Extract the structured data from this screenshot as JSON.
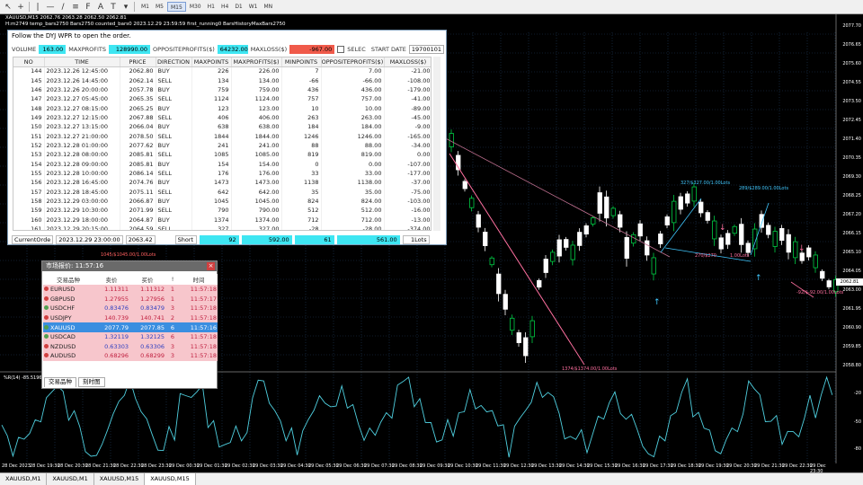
{
  "chart": {
    "symbol_line": "XAUUSD,M15  2062.76 2063.28 2062.50 2062.81",
    "info_line": "H:m2749 temp_bars2750 Bars2750 counted_bars0 2023.12.29 23:59:59 first_running0 BarsHistoryMaxBars2750",
    "prices": [
      "2077.70",
      "2076.65",
      "2075.60",
      "2074.55",
      "2073.50",
      "2072.45",
      "2071.40",
      "2070.35",
      "2069.30",
      "2068.25",
      "2067.20",
      "2066.15",
      "2065.10",
      "2064.05",
      "2063.00",
      "2061.95",
      "2060.90",
      "2059.85",
      "2058.80"
    ],
    "current_price": "2062.81",
    "indicator_label": "%R(14) -85.5196",
    "indicator_levels": [
      "-20",
      "-50",
      "-80"
    ],
    "times": [
      "28 Dec 2023",
      "28 Dec 19:30",
      "28 Dec 20:30",
      "28 Dec 21:30",
      "28 Dec 22:30",
      "28 Dec 23:30",
      "29 Dec 00:30",
      "29 Dec 01:30",
      "29 Dec 02:30",
      "29 Dec 03:30",
      "29 Dec 04:30",
      "29 Dec 05:30",
      "29 Dec 06:30",
      "29 Dec 07:30",
      "29 Dec 08:30",
      "29 Dec 09:30",
      "29 Dec 10:30",
      "29 Dec 11:30",
      "29 Dec 12:30",
      "29 Dec 13:30",
      "29 Dec 14:30",
      "29 Dec 15:30",
      "29 Dec 16:30",
      "29 Dec 17:30",
      "29 Dec 18:30",
      "29 Dec 19:30",
      "29 Dec 20:30",
      "29 Dec 21:30",
      "29 Dec 22:30",
      "29 Dec 23:30"
    ],
    "annotations": {
      "a1": "1045/$1045.00/1.00Lots",
      "a2": "327/$327.00/1.00Lots",
      "a3": "289/$289.00/1.00Lots",
      "a4": "270/$270",
      "a5": "1.00Lots",
      "a6": "1374/$1374.00/1.00Lots",
      "a7": "-92/$-92.00/1.00Lots"
    },
    "colors": {
      "bull": "#ffffff",
      "bear": "#00cc44",
      "indicator": "#4fd0e0"
    }
  },
  "toolbar": {
    "timeframes": [
      "M1",
      "M5",
      "M15",
      "M30",
      "H1",
      "H4",
      "D1",
      "W1",
      "MN"
    ],
    "active_timeframe": "M15"
  },
  "tabs": [
    "XAUUSD,M1",
    "XAUUSD,M1",
    "XAUUSD,M15",
    "XAUUSD,M15"
  ],
  "panel1": {
    "title": "Follow the DYJ WPR to open the order.",
    "volume_label": "VOLUME",
    "volume": "163.00",
    "maxprofits_label": "MAXPROFITS",
    "maxprofits": "128990.00",
    "opp_label": "OPPOSITEPROFITS($)",
    "opp": "64232.00",
    "maxloss_label": "MAXLOSS($)",
    "maxloss": "-967.00",
    "selec_label": "SELEC",
    "start_label": "START DATE",
    "start_date": "19700101",
    "columns": [
      "NO",
      "TIME",
      "PRICE",
      "DIRECTION",
      "MAXPOINTS",
      "MAXPROFITS($)",
      "MINPOINTS",
      "OPPOSITEPROFITS($)",
      "MAXLOSS($)"
    ],
    "rows": [
      [
        "144",
        "2023.12.26 12:45:00",
        "2062.80",
        "BUY",
        "226",
        "226.00",
        "7",
        "7.00",
        "-21.00"
      ],
      [
        "145",
        "2023.12.26 14:45:00",
        "2062.14",
        "SELL",
        "134",
        "134.00",
        "-66",
        "-66.00",
        "-108.00"
      ],
      [
        "146",
        "2023.12.26 20:00:00",
        "2057.78",
        "BUY",
        "759",
        "759.00",
        "436",
        "436.00",
        "-179.00"
      ],
      [
        "147",
        "2023.12.27 05:45:00",
        "2065.35",
        "SELL",
        "1124",
        "1124.00",
        "757",
        "757.00",
        "-41.00"
      ],
      [
        "148",
        "2023.12.27 08:15:00",
        "2065.25",
        "BUY",
        "123",
        "123.00",
        "10",
        "10.00",
        "-89.00"
      ],
      [
        "149",
        "2023.12.27 12:15:00",
        "2067.88",
        "SELL",
        "406",
        "406.00",
        "263",
        "263.00",
        "-45.00"
      ],
      [
        "150",
        "2023.12.27 13:15:00",
        "2066.04",
        "BUY",
        "638",
        "638.00",
        "184",
        "184.00",
        "-9.00"
      ],
      [
        "151",
        "2023.12.27 21:00:00",
        "2078.50",
        "SELL",
        "1844",
        "1844.00",
        "1246",
        "1246.00",
        "-165.00"
      ],
      [
        "152",
        "2023.12.28 01:00:00",
        "2077.62",
        "BUY",
        "241",
        "241.00",
        "88",
        "88.00",
        "-34.00"
      ],
      [
        "153",
        "2023.12.28 08:00:00",
        "2085.81",
        "SELL",
        "1085",
        "1085.00",
        "819",
        "819.00",
        "0.00"
      ],
      [
        "154",
        "2023.12.28 09:00:00",
        "2085.81",
        "BUY",
        "154",
        "154.00",
        "0",
        "0.00",
        "-107.00"
      ],
      [
        "155",
        "2023.12.28 10:00:00",
        "2086.14",
        "SELL",
        "176",
        "176.00",
        "33",
        "33.00",
        "-177.00"
      ],
      [
        "156",
        "2023.12.28 16:45:00",
        "2074.76",
        "BUY",
        "1473",
        "1473.00",
        "1138",
        "1138.00",
        "-37.00"
      ],
      [
        "157",
        "2023.12.28 18:45:00",
        "2075.11",
        "SELL",
        "642",
        "642.00",
        "35",
        "35.00",
        "-75.00"
      ],
      [
        "158",
        "2023.12.29 03:00:00",
        "2066.87",
        "BUY",
        "1045",
        "1045.00",
        "824",
        "824.00",
        "-103.00"
      ],
      [
        "159",
        "2023.12.29 10:30:00",
        "2071.99",
        "SELL",
        "790",
        "790.00",
        "512",
        "512.00",
        "-16.00"
      ],
      [
        "160",
        "2023.12.29 18:00:00",
        "2064.87",
        "BUY",
        "1374",
        "1374.00",
        "712",
        "712.00",
        "-13.00"
      ],
      [
        "161",
        "2023.12.29 20:15:00",
        "2064.59",
        "SELL",
        "327",
        "327.00",
        "-28",
        "-28.00",
        "-374.00"
      ],
      [
        "162",
        "2023.12.29 21:30:00",
        "2064.94",
        "BUY",
        "270",
        "270.00",
        "-35",
        "-35.00",
        "-111.00"
      ],
      [
        "163",
        "2023.12.29 23:00:00",
        "2063.42",
        "SELL",
        "289",
        "289.00",
        "-152",
        "-152.00",
        "-231.00"
      ]
    ],
    "footer": {
      "label": "CurrentOrde",
      "time": "2023.12.29 23:00:00",
      "price": "2063.42",
      "direction": "Short",
      "maxpoints": "92",
      "maxprofits": "592.00",
      "minpoints": "61",
      "opp": "561.00",
      "lots": "1Lots"
    }
  },
  "panel2": {
    "title": "市场报价: 11:57:16",
    "columns": [
      "交易品种",
      "卖价",
      "买价",
      "!",
      "时间"
    ],
    "rows": [
      {
        "sym": "EURUSD",
        "bid": "1.11311",
        "ask": "1.11312",
        "spread": "1",
        "time": "11:57:18",
        "style": "pink",
        "dot": "#d04040"
      },
      {
        "sym": "GBPUSD",
        "bid": "1.27955",
        "ask": "1.27956",
        "spread": "1",
        "time": "11:57:17",
        "style": "pink",
        "dot": "#d04040"
      },
      {
        "sym": "USDCHF",
        "bid": "0.83476",
        "ask": "0.83479",
        "spread": "3",
        "time": "11:57:18",
        "style": "pink",
        "dot": "#50a050"
      },
      {
        "sym": "USDJPY",
        "bid": "140.739",
        "ask": "140.741",
        "spread": "2",
        "time": "11:57:18",
        "style": "pink",
        "dot": "#d04040"
      },
      {
        "sym": "XAUUSD",
        "bid": "2077.79",
        "ask": "2077.85",
        "spread": "6",
        "time": "11:57:16",
        "style": "blue",
        "dot": "#50a050"
      },
      {
        "sym": "USDCAD",
        "bid": "1.32119",
        "ask": "1.32125",
        "spread": "6",
        "time": "11:57:18",
        "style": "pink",
        "dot": "#50a050"
      },
      {
        "sym": "NZDUSD",
        "bid": "0.63303",
        "ask": "0.63306",
        "spread": "3",
        "time": "11:57:18",
        "style": "pink",
        "dot": "#d04040"
      },
      {
        "sym": "AUDUSD",
        "bid": "0.68296",
        "ask": "0.68299",
        "spread": "3",
        "time": "11:57:18",
        "style": "pink",
        "dot": "#d04040"
      }
    ],
    "tabs": [
      "交易品种",
      "刻时图"
    ]
  }
}
